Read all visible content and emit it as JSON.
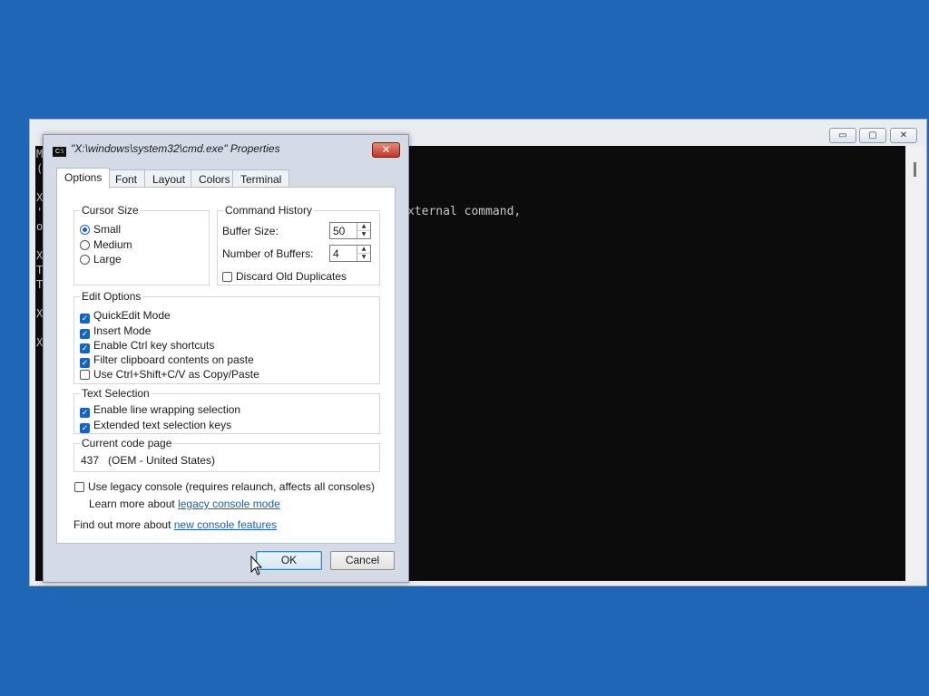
{
  "console": {
    "edge_chars": [
      "M",
      "(",
      "X",
      "'",
      "o",
      "X",
      "T",
      "T",
      "X",
      "X"
    ],
    "visible_line": "xternal command,",
    "controls": {
      "minimize": "▭",
      "restore": "▢",
      "close": "✕"
    }
  },
  "dialog": {
    "icon_text": "C:\\",
    "title": "\"X:\\windows\\system32\\cmd.exe\" Properties",
    "close_glyph": "✕",
    "tabs": [
      {
        "label": "Options",
        "active": true
      },
      {
        "label": "Font",
        "active": false
      },
      {
        "label": "Layout",
        "active": false
      },
      {
        "label": "Colors",
        "active": false
      },
      {
        "label": "Terminal",
        "active": false
      }
    ],
    "cursor_size": {
      "legend": "Cursor Size",
      "options": [
        {
          "label": "Small",
          "selected": true
        },
        {
          "label": "Medium",
          "selected": false
        },
        {
          "label": "Large",
          "selected": false
        }
      ]
    },
    "command_history": {
      "legend": "Command History",
      "buffer_size_label": "Buffer Size:",
      "buffer_size_value": "50",
      "num_buffers_label": "Number of Buffers:",
      "num_buffers_value": "4",
      "discard_label": "Discard Old Duplicates",
      "discard_checked": false
    },
    "edit_options": {
      "legend": "Edit Options",
      "items": [
        {
          "label": "QuickEdit Mode",
          "checked": true
        },
        {
          "label": "Insert Mode",
          "checked": true
        },
        {
          "label": "Enable Ctrl key shortcuts",
          "checked": true
        },
        {
          "label": "Filter clipboard contents on paste",
          "checked": true
        },
        {
          "label": "Use Ctrl+Shift+C/V as Copy/Paste",
          "checked": false
        }
      ]
    },
    "text_selection": {
      "legend": "Text Selection",
      "items": [
        {
          "label": "Enable line wrapping selection",
          "checked": true
        },
        {
          "label": "Extended text selection keys",
          "checked": true
        }
      ]
    },
    "code_page": {
      "legend": "Current code page",
      "value": "437   (OEM - United States)"
    },
    "legacy": {
      "label": "Use legacy console (requires relaunch, affects all consoles)",
      "checked": false,
      "learn_prefix": "Learn more about ",
      "learn_link": "legacy console mode"
    },
    "find_out": {
      "prefix": "Find out more about ",
      "link": "new console features"
    },
    "buttons": {
      "ok": "OK",
      "cancel": "Cancel"
    }
  }
}
